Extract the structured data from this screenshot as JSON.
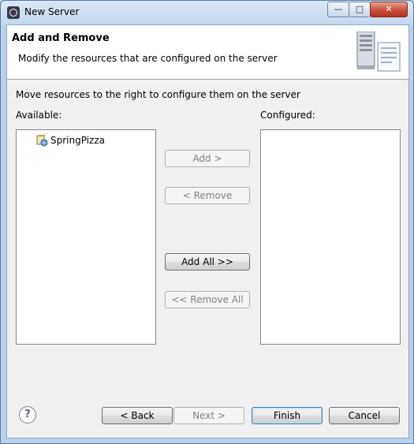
{
  "window": {
    "title": "New Server",
    "icon": "eclipse-server-icon"
  },
  "banner": {
    "title": "Add and Remove",
    "description": "Modify the resources that are configured on the server",
    "icon": "server-wizard-icon"
  },
  "instruction": "Move resources to the right to configure them on the server",
  "available": {
    "label": "Available:",
    "items": [
      {
        "label": "SpringPizza",
        "icon": "web-project-icon"
      }
    ]
  },
  "configured": {
    "label": "Configured:",
    "items": []
  },
  "transfer_buttons": {
    "add": "Add >",
    "remove": "< Remove",
    "add_all": "Add All >>",
    "remove_all": "<< Remove All"
  },
  "footer": {
    "back": "< Back",
    "next": "Next >",
    "finish": "Finish",
    "cancel": "Cancel",
    "help_icon": "help-icon"
  }
}
